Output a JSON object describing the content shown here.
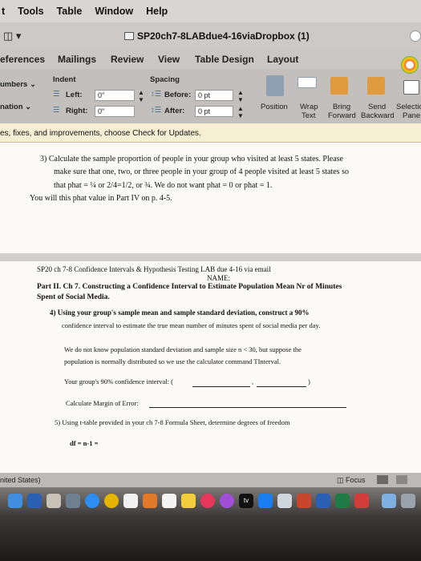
{
  "menubar": {
    "items": [
      "t",
      "Tools",
      "Table",
      "Window",
      "Help"
    ]
  },
  "titlebar": {
    "doc_title": "SP20ch7-8LABdue4-16viaDropbox (1)"
  },
  "tabs": [
    "eferences",
    "Mailings",
    "Review",
    "View",
    "Table Design",
    "Layout"
  ],
  "ribbon": {
    "numbers_label": "umbers",
    "nation_label": "nation",
    "indent_heading": "Indent",
    "left_label": "Left:",
    "left_value": "0\"",
    "right_label": "Right:",
    "right_value": "0\"",
    "spacing_heading": "Spacing",
    "before_label": "Before:",
    "before_value": "0 pt",
    "after_label": "After:",
    "after_value": "0 pt",
    "position_label": "Position",
    "wrap_text_line1": "Wrap",
    "wrap_text_line2": "Text",
    "bring_forward_line1": "Bring",
    "bring_forward_line2": "Forward",
    "send_backward_line1": "Send",
    "send_backward_line2": "Backward",
    "selection_pane_line1": "Selectic",
    "selection_pane_line2": "Pane"
  },
  "message_bar": "es, fixes, and improvements, choose Check for Updates.",
  "page1": {
    "q3_line1": "3)  Calculate the sample proportion of people in your group who visited at least 5 states. Please",
    "q3_line2": "make sure that one, two, or three people in your group of 4 people visited at least 5 states so",
    "q3_line3": "that phat = ¼ or 2/4=1/2, or ¾. We do not want phat = 0 or phat = 1.",
    "q3_line4": "You will this phat value in Part IV on p. 4-5."
  },
  "page2": {
    "header": "SP20 ch 7-8 Confidence Intervals & Hypothesis Testing LAB due 4-16 via email",
    "name_label": "NAME:",
    "part2_line1": "Part II. Ch 7. Constructing a Confidence Interval to Estimate Population Mean Nr of Minutes",
    "part2_line2": "Spent of Social Media.",
    "q4_line1": "4)  Using your group's sample mean and sample standard deviation, construct a 90%",
    "q4_line2": "confidence interval to estimate the true mean number of minutes spent of social media per day.",
    "note_line1": "We do not know population standard deviation and sample size n < 30, but suppose the",
    "note_line2": "population is normally distributed so we use the calculator command TInterval.",
    "ci_label": "Your group's 90% confidence interval: (",
    "ci_comma": ",",
    "ci_close": ")",
    "margin_label": "Calculate Margin of Error:",
    "q5_line": "5)  Using t-table provided in your ch 7-8 Formula Sheet, determine degrees of freedom",
    "df_line": "df = n-1 ="
  },
  "statusbar": {
    "language": "nited States)",
    "focus_label": "Focus"
  },
  "dock": {
    "tv_label": "tv"
  },
  "colors": {
    "ribbon_bg": "#c2bfbc",
    "message_bar_bg": "#f6efd3",
    "page_bg": "#fbfaf8",
    "dock_bg": "#2a2827"
  }
}
